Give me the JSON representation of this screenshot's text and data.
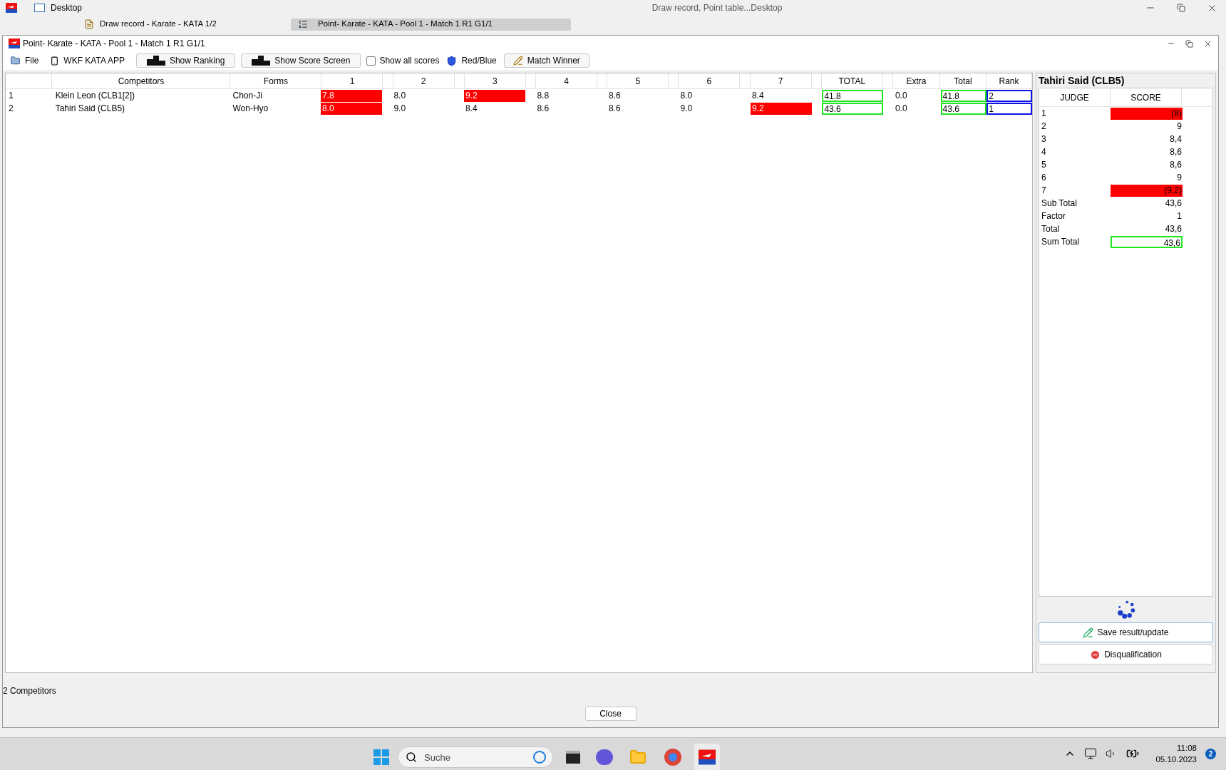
{
  "desktop": {
    "label": "Desktop",
    "title": "Draw record, Point table...Desktop"
  },
  "tabs": [
    {
      "label": "Draw record - Karate - KATA 1/2",
      "selected": false
    },
    {
      "label": "Point- Karate - KATA - Pool 1 - Match 1 R1 G1/1",
      "selected": true
    }
  ],
  "window": {
    "title": "Point- Karate - KATA - Pool 1 - Match 1 R1 G1/1"
  },
  "toolbar": {
    "file": "File",
    "app": "WKF KATA APP",
    "show_ranking": "Show Ranking",
    "show_score_screen": "Show Score Screen",
    "show_all_scores": {
      "label": "Show all scores",
      "checked": false
    },
    "red_blue": "Red/Blue",
    "match_winner": "Match Winner"
  },
  "table": {
    "columns": [
      "Competitors",
      "Forms",
      "1",
      "2",
      "3",
      "4",
      "5",
      "6",
      "7",
      "TOTAL",
      "Extra",
      "Total",
      "Rank"
    ],
    "rows": [
      {
        "number": "1",
        "competitor": "Klein Leon (CLB1[2])",
        "form": "Chon-Ji",
        "scores": [
          {
            "value": "7.8",
            "dropped": true
          },
          {
            "value": "8.0",
            "dropped": false
          },
          {
            "value": "9.2",
            "dropped": true
          },
          {
            "value": "8.8",
            "dropped": false
          },
          {
            "value": "8.6",
            "dropped": false
          },
          {
            "value": "8.0",
            "dropped": false
          },
          {
            "value": "8.4",
            "dropped": false
          }
        ],
        "total": "41.8",
        "extra": "0.0",
        "final_total": "41.8",
        "rank": "2"
      },
      {
        "number": "2",
        "competitor": "Tahiri Said (CLB5)",
        "form": "Won-Hyo",
        "scores": [
          {
            "value": "8.0",
            "dropped": true
          },
          {
            "value": "9.0",
            "dropped": false
          },
          {
            "value": "8.4",
            "dropped": false
          },
          {
            "value": "8.6",
            "dropped": false
          },
          {
            "value": "8.6",
            "dropped": false
          },
          {
            "value": "9.0",
            "dropped": false
          },
          {
            "value": "9.2",
            "dropped": true
          }
        ],
        "total": "43.6",
        "extra": "0.0",
        "final_total": "43.6",
        "rank": "1"
      }
    ]
  },
  "detail": {
    "title": "Tahiri Said (CLB5)",
    "columns": [
      "JUDGE",
      "SCORE"
    ],
    "rows": [
      {
        "label": "1",
        "score": "(8)",
        "dropped": true
      },
      {
        "label": "2",
        "score": "9",
        "dropped": false
      },
      {
        "label": "3",
        "score": "8,4",
        "dropped": false
      },
      {
        "label": "4",
        "score": "8,6",
        "dropped": false
      },
      {
        "label": "5",
        "score": "8,6",
        "dropped": false
      },
      {
        "label": "6",
        "score": "9",
        "dropped": false
      },
      {
        "label": "7",
        "score": "(9,2)",
        "dropped": true
      },
      {
        "label": "Sub Total",
        "score": "43,6",
        "dropped": false
      },
      {
        "label": "Factor",
        "score": "1",
        "dropped": false
      },
      {
        "label": "Total",
        "score": "43,6",
        "dropped": false
      },
      {
        "label": "Sum Total",
        "score": "43,6",
        "dropped": false,
        "kind": "sum"
      }
    ],
    "save_button": "Save result/update",
    "disqualification_button": "Disqualification"
  },
  "status": "2 Competitors",
  "close_button": "Close",
  "taskbar": {
    "search_placeholder": "Suche",
    "time": "11:08",
    "date": "05.10.2023",
    "notifications": "2"
  }
}
